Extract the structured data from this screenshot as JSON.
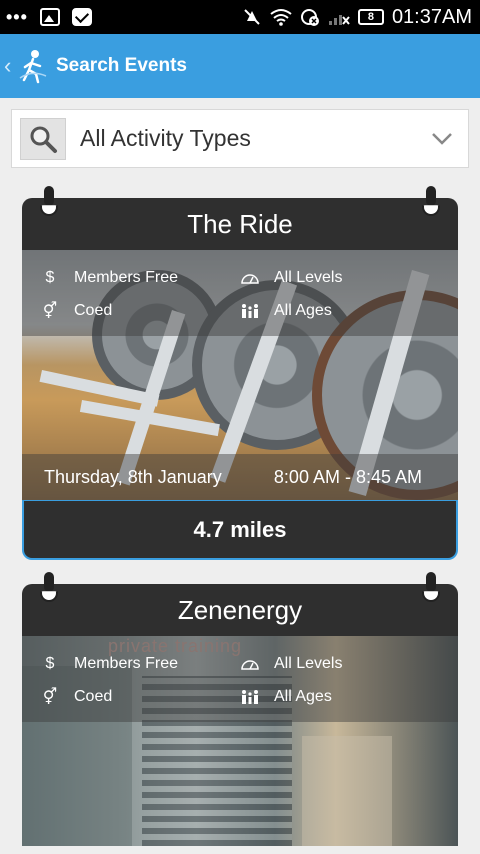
{
  "status_bar": {
    "time": "01:37AM",
    "battery": "8",
    "icons": [
      "overflow-dots-icon",
      "image-icon",
      "mail-icon",
      "mute-icon",
      "wifi-icon",
      "sync-icon",
      "signal-icon",
      "battery-icon"
    ]
  },
  "app_bar": {
    "title": "Search Events",
    "color": "#3a9ee0"
  },
  "filter": {
    "selected": "All Activity Types"
  },
  "events": [
    {
      "name": "The Ride",
      "price": "Members Free",
      "level": "All Levels",
      "gender": "Coed",
      "ages": "All Ages",
      "date": "Thursday, 8th January",
      "time": "8:00 AM - 8:45 AM",
      "distance": "4.7 miles"
    },
    {
      "name": "Zenenergy",
      "image_text": "private training",
      "price": "Members Free",
      "level": "All Levels",
      "gender": "Coed",
      "ages": "All Ages"
    }
  ]
}
